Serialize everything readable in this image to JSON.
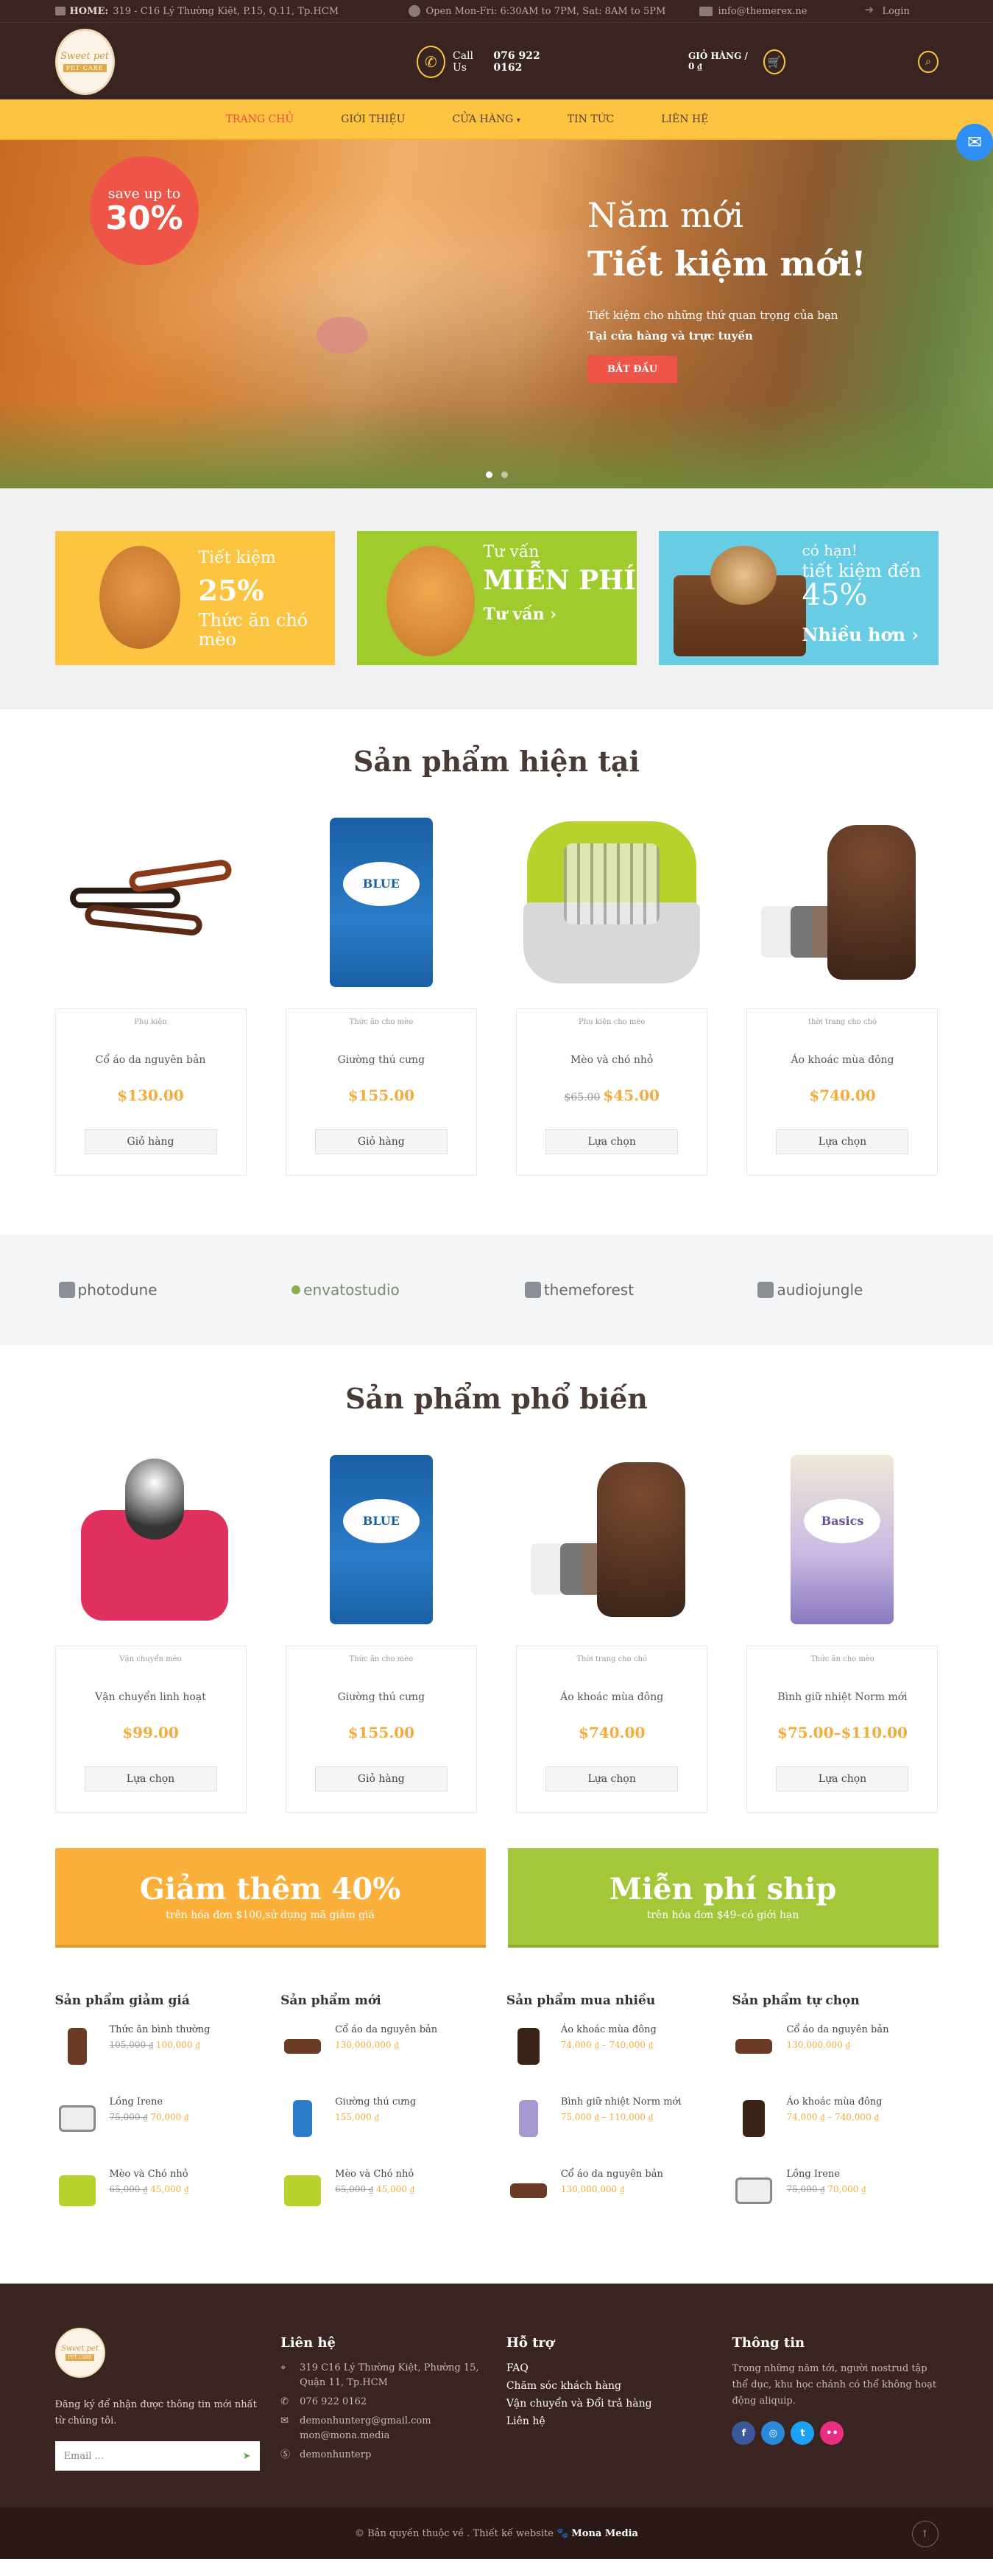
{
  "topbar": {
    "home_label": "HOME:",
    "address": "319 - C16 Lý Thường Kiệt, P.15, Q.11, Tp.HCM",
    "hours": "Open Mon-Fri: 6:30AM to 7PM, Sat: 8AM to 5PM",
    "email": "info@themerex.ne",
    "login": "Login"
  },
  "header": {
    "logo_line1": "Sweet pet",
    "logo_line2": "PET CARE",
    "call_label": "Call Us",
    "phone": "076 922 0162",
    "cart_label": "GIỎ HÀNG / 0 ₫"
  },
  "nav": {
    "items": [
      "TRANG CHỦ",
      "GIỚI THIỆU",
      "CỬA HÀNG",
      "TIN TỨC",
      "LIÊN HỆ"
    ]
  },
  "hero": {
    "badge_small": "save up to",
    "badge_big": "30%",
    "title1": "Năm mới",
    "title2": "Tiết kiệm mới!",
    "line1": "Tiết kiệm cho những thứ quan trọng của bạn",
    "line2": "Tại cửa hàng và trực tuyến",
    "button": "BẮT ĐẦU"
  },
  "promos": {
    "p1": {
      "t1": "Tiết kiệm",
      "t2": "25%",
      "t3": "Thức ăn chó mèo"
    },
    "p2": {
      "t1": "Tư vấn",
      "t2": "MIỄN PHÍ",
      "t3": "Tư vấn ›"
    },
    "p3": {
      "t1": "có hạn!",
      "t2": "tiết kiệm đến",
      "t3": "45%",
      "t4": "Nhiều hơn ›"
    }
  },
  "current_products": {
    "title": "Sản phẩm hiện tại",
    "items": [
      {
        "cat": "Phụ kiện",
        "name": "Cổ áo da nguyên bản",
        "old": "",
        "price": "$130.00",
        "button": "Giỏ hàng"
      },
      {
        "cat": "Thức ăn cho mèo",
        "name": "Giường thú cưng",
        "old": "",
        "price": "$155.00",
        "button": "Giỏ hàng"
      },
      {
        "cat": "Phụ kiện cho mèo",
        "name": "Mèo và chó nhỏ",
        "old": "$65.00",
        "price": "$45.00",
        "button": "Lựa chọn"
      },
      {
        "cat": "thời trang cho chó",
        "name": "Áo khoác mùa đông",
        "old": "",
        "price": "$740.00",
        "button": "Lựa chọn"
      }
    ]
  },
  "brands": [
    "photodune",
    "envatostudio",
    "themeforest",
    "audiojungle"
  ],
  "popular_products": {
    "title": "Sản phẩm phổ biến",
    "items": [
      {
        "cat": "Vận chuyển mèo",
        "name": "Vận chuyển linh hoạt",
        "old": "",
        "price": "$99.00",
        "button": "Lựa chọn"
      },
      {
        "cat": "Thức ăn cho mèo",
        "name": "Giường thú cưng",
        "old": "",
        "price": "$155.00",
        "button": "Giỏ hàng"
      },
      {
        "cat": "Thời trang cho chó",
        "name": "Áo khoác mùa đông",
        "old": "",
        "price": "$740.00",
        "button": "Lựa chọn"
      },
      {
        "cat": "Thức ăn cho mèo",
        "name": "Bình giữ nhiệt Norm mới",
        "old": "",
        "price": "$75.00–$110.00",
        "button": "Lựa chọn"
      }
    ]
  },
  "banners": {
    "b1": {
      "title": "Giảm thêm 40%",
      "sub": "trên hóa đơn $100,sử dụng mã giảm giá"
    },
    "b2": {
      "title": "Miễn phí ship",
      "sub": "trên hóa đơn $49–có giới hạn"
    }
  },
  "widgets": [
    {
      "title": "Sản phẩm giảm giá",
      "items": [
        {
          "name": "Thức ăn bình thường",
          "old": "105,000 ₫",
          "price": "100,000 ₫"
        },
        {
          "name": "Lồng Irene",
          "old": "75,000 ₫",
          "price": "70,000 ₫"
        },
        {
          "name": "Mèo và Chó nhỏ",
          "old": "65,000 ₫",
          "price": "45,000 ₫"
        }
      ]
    },
    {
      "title": "Sản phẩm mới",
      "items": [
        {
          "name": "Cổ áo da nguyên bản",
          "old": "",
          "price": "130,000,000 ₫"
        },
        {
          "name": "Giường thú cưng",
          "old": "",
          "price": "155,000 ₫"
        },
        {
          "name": "Mèo và Chó nhỏ",
          "old": "65,000 ₫",
          "price": "45,000 ₫"
        }
      ]
    },
    {
      "title": "Sản phẩm mua nhiều",
      "items": [
        {
          "name": "Áo khoác mùa đông",
          "old": "",
          "price": "74,000 ₫ – 740,000 ₫"
        },
        {
          "name": "Bình giữ nhiệt Norm mới",
          "old": "",
          "price": "75,000 ₫ – 110,000 ₫"
        },
        {
          "name": "Cổ áo da nguyên bản",
          "old": "",
          "price": "130,000,000 ₫"
        }
      ]
    },
    {
      "title": "Sản phẩm tự chọn",
      "items": [
        {
          "name": "Cổ áo da nguyên bản",
          "old": "",
          "price": "130,000,000 ₫"
        },
        {
          "name": "Áo khoác mùa đông",
          "old": "",
          "price": "74,000 ₫ – 740,000 ₫"
        },
        {
          "name": "Lồng Irene",
          "old": "75,000 ₫",
          "price": "70,000 ₫"
        }
      ]
    }
  ],
  "footer": {
    "desc": "Đăng ký để nhận được thông tin mới nhất từ chúng tôi.",
    "email_placeholder": "Email ...",
    "contact_title": "Liên hệ",
    "contact_address": "319 C16 Lý Thường Kiệt, Phường 15, Quận 11, Tp.HCM",
    "contact_phone": "076 922 0162",
    "contact_email1": "demonhunterg@gmail.com",
    "contact_email2": "mon@mona.media",
    "contact_skype": "demonhunterp",
    "support_title": "Hỗ trợ",
    "support_links": [
      "FAQ",
      "Chăm sóc khách hàng",
      "Vận chuyển và Đổi trả hàng",
      "Liên hệ"
    ],
    "info_title": "Thông tin",
    "info_text": "Trong những năm tới, người nostrud tập thể dục, khu học chánh có thể không hoạt động aliquip.",
    "copyright": "© Bản quyền thuộc về . Thiết kế website",
    "designer": "Mona Media"
  },
  "colors": {
    "dark_brown": "#3a2421",
    "yellow": "#fdc441",
    "red": "#ef5448",
    "green": "#9fcb2c",
    "blue": "#67cce4",
    "price": "#f4ad3c"
  }
}
